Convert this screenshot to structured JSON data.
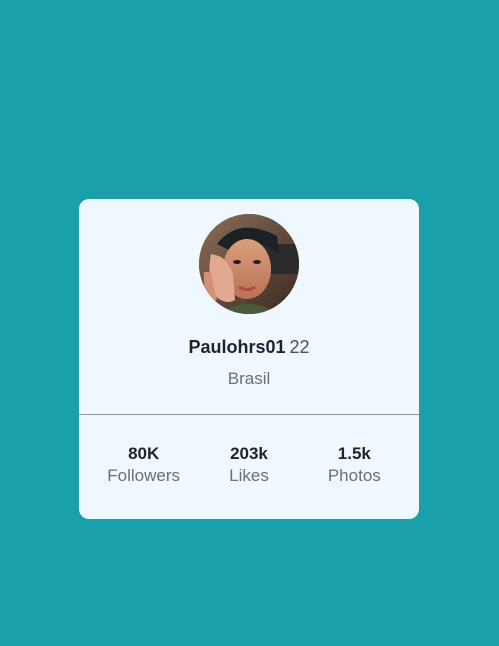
{
  "profile": {
    "username": "Paulohrs01",
    "age": "22",
    "location": "Brasil",
    "avatar_icon": "profile-photo"
  },
  "stats": [
    {
      "value": "80K",
      "label": "Followers"
    },
    {
      "value": "203k",
      "label": "Likes"
    },
    {
      "value": "1.5k",
      "label": "Photos"
    }
  ],
  "colors": {
    "background": "#19a0aa",
    "card": "#eff7ff",
    "text_primary": "#1d2333",
    "text_secondary": "#6b6f76"
  }
}
